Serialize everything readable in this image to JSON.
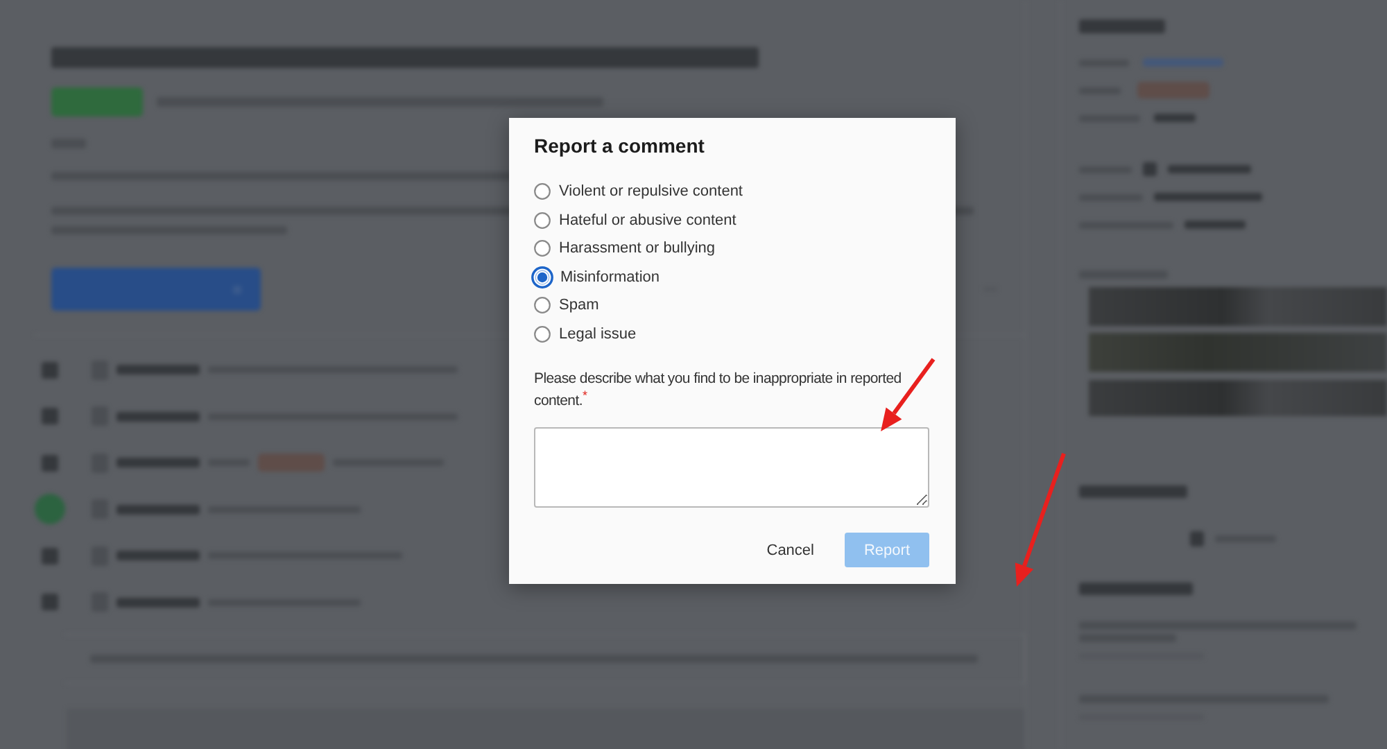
{
  "dialog": {
    "title": "Report a comment",
    "options": [
      {
        "label": "Violent or repulsive content",
        "selected": false
      },
      {
        "label": "Hateful or abusive content",
        "selected": false
      },
      {
        "label": "Harassment or bullying",
        "selected": false
      },
      {
        "label": "Misinformation",
        "selected": true
      },
      {
        "label": "Spam",
        "selected": false
      },
      {
        "label": "Legal issue",
        "selected": false
      }
    ],
    "description": {
      "text": "Please describe what you find to be inappropriate in reported content.",
      "required_mark": "*"
    },
    "buttons": [
      {
        "label": "Cancel",
        "kind": "text",
        "disabled": false
      },
      {
        "label": "Report",
        "kind": "primary",
        "disabled": true
      }
    ]
  }
}
